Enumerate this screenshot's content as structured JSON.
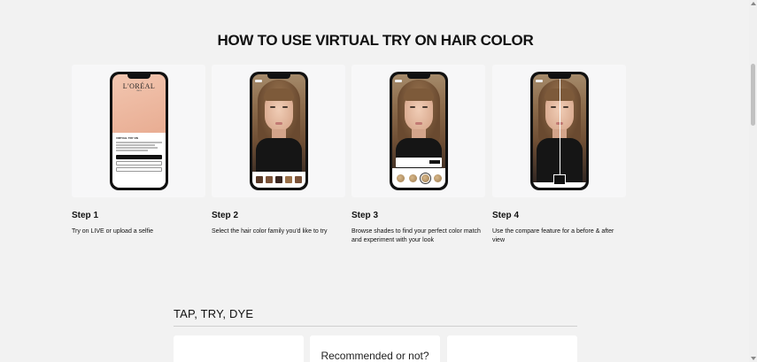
{
  "page_title": "HOW TO USE VIRTUAL TRY ON HAIR COLOR",
  "steps": [
    {
      "title": "Step 1",
      "description": "Try on LIVE or upload a selfie"
    },
    {
      "title": "Step 2",
      "description": "Select the hair color family you'd like to try"
    },
    {
      "title": "Step 3",
      "description": "Browse shades to find your perfect color match and experiment with your look"
    },
    {
      "title": "Step 4",
      "description": "Use the compare feature for a before & after view"
    }
  ],
  "phone1": {
    "brand": "L'ORÉAL",
    "brand_sub": "PARIS",
    "heading": "VIRTUAL TRY ON"
  },
  "section": {
    "title": "TAP, TRY, DYE"
  },
  "cards": {
    "middle_label": "Recommended or not?"
  },
  "colors": {
    "background": "#f2f2f2",
    "card": "#f7f7f8",
    "phone_frame": "#111111"
  }
}
